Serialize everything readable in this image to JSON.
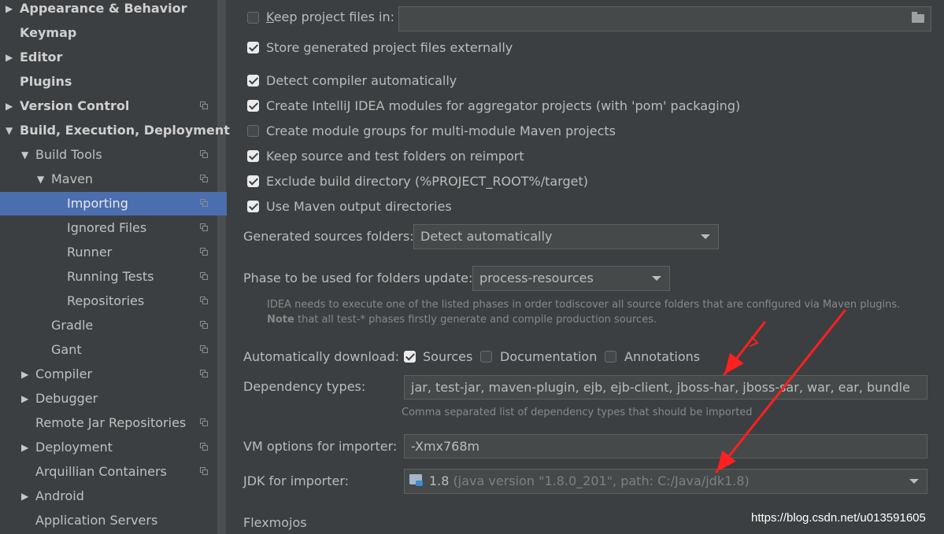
{
  "sidebar": {
    "items": [
      {
        "label": "Appearance & Behavior",
        "bold": true,
        "expand": "collapsed"
      },
      {
        "label": "Keymap",
        "bold": true
      },
      {
        "label": "Editor",
        "bold": true,
        "expand": "collapsed"
      },
      {
        "label": "Plugins",
        "bold": true
      },
      {
        "label": "Version Control",
        "bold": true,
        "expand": "collapsed",
        "copy": true
      },
      {
        "label": "Build, Execution, Deployment",
        "bold": true,
        "expand": "expanded"
      },
      {
        "label": "Build Tools",
        "expand": "expanded",
        "copy": true
      },
      {
        "label": "Maven",
        "expand": "expanded",
        "copy": true
      },
      {
        "label": "Importing",
        "selected": true,
        "copy": true
      },
      {
        "label": "Ignored Files",
        "copy": true
      },
      {
        "label": "Runner",
        "copy": true
      },
      {
        "label": "Running Tests",
        "copy": true
      },
      {
        "label": "Repositories",
        "copy": true
      },
      {
        "label": "Gradle",
        "copy": true
      },
      {
        "label": "Gant",
        "copy": true
      },
      {
        "label": "Compiler",
        "expand": "collapsed",
        "copy": true
      },
      {
        "label": "Debugger",
        "expand": "collapsed"
      },
      {
        "label": "Remote Jar Repositories",
        "copy": true
      },
      {
        "label": "Deployment",
        "expand": "collapsed",
        "copy": true
      },
      {
        "label": "Arquillian Containers",
        "copy": true
      },
      {
        "label": "Android",
        "expand": "collapsed"
      },
      {
        "label": "Application Servers"
      }
    ]
  },
  "main": {
    "keep_project_files": {
      "label": "Keep project files in:",
      "checked": false,
      "value": ""
    },
    "store_externally": {
      "label": "Store generated project files externally",
      "checked": true
    },
    "detect_compiler": {
      "label": "Detect compiler automatically",
      "checked": true
    },
    "create_modules": {
      "label": "Create IntelliJ IDEA modules for aggregator projects (with 'pom' packaging)",
      "checked": true
    },
    "create_groups": {
      "label": "Create module groups for multi-module Maven projects",
      "checked": false
    },
    "keep_source": {
      "label": "Keep source and test folders on reimport",
      "checked": true
    },
    "exclude_build": {
      "label": "Exclude build directory (%PROJECT_ROOT%/target)",
      "checked": true
    },
    "use_output": {
      "label": "Use Maven output directories",
      "checked": true
    },
    "generated_sources": {
      "label": "Generated sources folders:",
      "value": "Detect automatically"
    },
    "phase": {
      "label": "Phase to be used for folders update:",
      "value": "process-resources"
    },
    "phase_hint_1": "IDEA needs to execute one of the listed phases in order todiscover all source folders that are configured via Maven plugins.",
    "phase_hint_2_bold": "Note",
    "phase_hint_2_rest": " that all test-* phases firstly generate and compile production sources.",
    "auto_download": {
      "label": "Automatically download:",
      "sources": {
        "label": "Sources",
        "checked": true
      },
      "documentation": {
        "label": "Documentation",
        "checked": false
      },
      "annotations": {
        "label": "Annotations",
        "checked": false
      }
    },
    "dependency_types": {
      "label": "Dependency types:",
      "value": "jar, test-jar, maven-plugin, ejb, ejb-client, jboss-har, jboss-sar, war, ear, bundle",
      "hint": "Comma separated list of dependency types that should be imported"
    },
    "vm_options": {
      "label": "VM options for importer:",
      "value": "-Xmx768m"
    },
    "jdk": {
      "label": "JDK for importer:",
      "version": "1.8",
      "detail": " (java version \"1.8.0_201\", path: C:/Java/jdk1.8)"
    },
    "flexmojos": "Flexmojos"
  },
  "colors": {
    "annotation_arrow": "#ff2020",
    "selection": "#4b6eaf"
  },
  "watermark": "https://blog.csdn.net/u013591605"
}
